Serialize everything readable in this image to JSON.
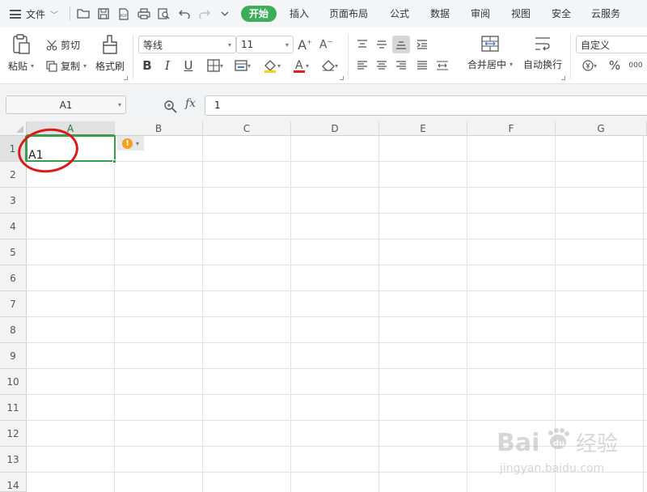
{
  "menubar": {
    "file_label": "文件",
    "tabs": [
      {
        "label": "开始",
        "active": true
      },
      {
        "label": "插入"
      },
      {
        "label": "页面布局"
      },
      {
        "label": "公式"
      },
      {
        "label": "数据"
      },
      {
        "label": "审阅"
      },
      {
        "label": "视图"
      },
      {
        "label": "安全"
      },
      {
        "label": "云服务"
      }
    ]
  },
  "ribbon": {
    "paste": "粘贴",
    "cut": "剪切",
    "copy": "复制",
    "format_painter": "格式刷",
    "font_name": "等线",
    "font_size": "11",
    "bold": "B",
    "italic": "I",
    "underline": "U",
    "merge_center": "合并居中",
    "wrap_text": "自动换行",
    "number_format": "自定义",
    "percent": "%",
    "thousands": "000"
  },
  "formula_bar": {
    "name_box": "A1",
    "fx": "fx",
    "value": "1"
  },
  "sheet": {
    "columns": [
      "A",
      "B",
      "C",
      "D",
      "E",
      "F",
      "G"
    ],
    "rows": [
      "1",
      "2",
      "3",
      "4",
      "5",
      "6",
      "7",
      "8",
      "9",
      "10",
      "11",
      "12",
      "13",
      "14"
    ],
    "cell_a1": "A1"
  },
  "watermark": {
    "brand": "Bai",
    "brand2": "经验",
    "url": "jingyan.baidu.com"
  },
  "colors": {
    "accent_green": "#3cad5a",
    "selection_green": "#3a9d4e",
    "annotation_red": "#d81b1b"
  }
}
